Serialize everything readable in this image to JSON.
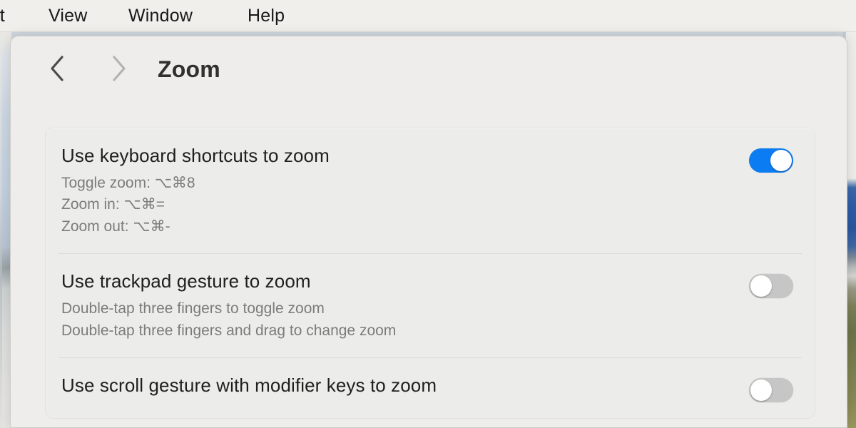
{
  "menubar": {
    "items": [
      {
        "label": "it",
        "name": "menu-edit"
      },
      {
        "label": "View",
        "name": "menu-view"
      },
      {
        "label": "Window",
        "name": "menu-window"
      },
      {
        "label": "Help",
        "name": "menu-help"
      }
    ]
  },
  "toolbar": {
    "back_icon": "chevron-left-icon",
    "forward_icon": "chevron-right-icon",
    "title": "Zoom"
  },
  "settings": {
    "rows": [
      {
        "title": "Use keyboard shortcuts to zoom",
        "sublines": [
          "Toggle zoom: ⌥⌘8",
          "Zoom in: ⌥⌘=",
          "Zoom out: ⌥⌘-"
        ],
        "toggle": "on"
      },
      {
        "title": "Use trackpad gesture to zoom",
        "sublines": [
          "Double-tap three fingers to toggle zoom",
          "Double-tap three fingers and drag to change zoom"
        ],
        "toggle": "off"
      },
      {
        "title": "Use scroll gesture with modifier keys to zoom",
        "sublines": [],
        "toggle": "off"
      }
    ]
  },
  "colors": {
    "accent_on": "#0b7cf1",
    "toggle_off": "#c6c6c6",
    "window_bg": "#eeedeb",
    "card_bg": "#ececea",
    "menubar_bg": "#f1efeb",
    "title_text": "#303030",
    "row_title_text": "#1f1f1f",
    "row_sub_text": "#7c7c7c"
  }
}
